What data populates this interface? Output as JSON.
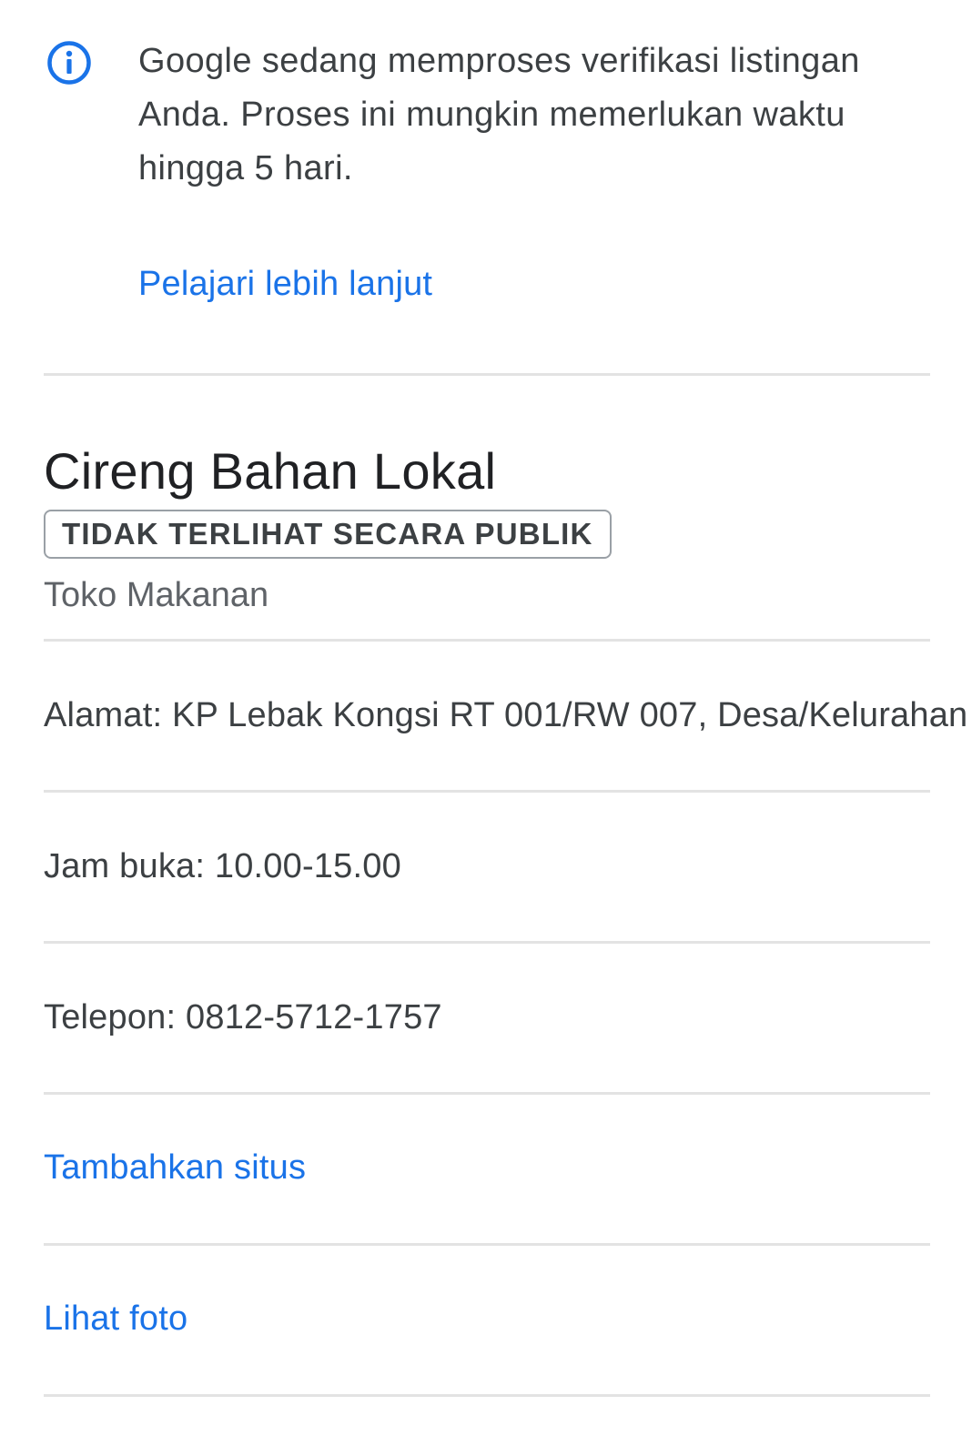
{
  "notice": {
    "icon": "info-icon",
    "accent_color": "#1a73e8",
    "message": "Google sedang memproses verifikasi listingan Anda. Proses ini mungkin memerlukan waktu hingga 5 hari.",
    "learn_more_label": "Pelajari lebih lanjut"
  },
  "business": {
    "name": "Cireng Bahan Lokal",
    "status_badge": "TIDAK TERLIHAT SECARA PUBLIK",
    "category": "Toko Makanan"
  },
  "details": {
    "address": "Alamat: KP Lebak Kongsi RT 001/RW 007, Desa/Kelurahan",
    "hours": "Jam buka: 10.00-15.00",
    "phone": "Telepon: 0812-5712-1757",
    "add_site_label": "Tambahkan situs",
    "view_photos_label": "Lihat foto"
  }
}
